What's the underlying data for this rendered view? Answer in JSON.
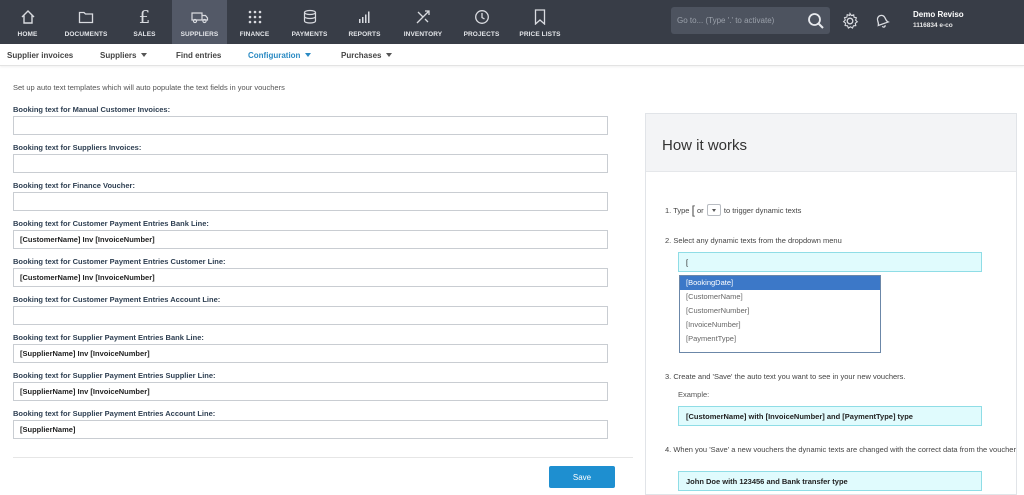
{
  "nav": {
    "items": [
      {
        "label": "HOME",
        "icon": "home-icon"
      },
      {
        "label": "DOCUMENTS",
        "icon": "folder-icon"
      },
      {
        "label": "SALES",
        "icon": "pound-icon"
      },
      {
        "label": "SUPPLIERS",
        "icon": "truck-icon",
        "active": true
      },
      {
        "label": "FINANCE",
        "icon": "grid-icon"
      },
      {
        "label": "PAYMENTS",
        "icon": "coins-icon"
      },
      {
        "label": "REPORTS",
        "icon": "bar-chart-icon"
      },
      {
        "label": "INVENTORY",
        "icon": "inventory-icon"
      },
      {
        "label": "PROJECTS",
        "icon": "clock-icon"
      },
      {
        "label": "PRICE LISTS",
        "icon": "bookmark-icon"
      }
    ]
  },
  "search": {
    "placeholder": "Go to... (Type '.' to activate)"
  },
  "user": {
    "name": "Demo Reviso",
    "account": "1116834 e-co"
  },
  "subnav": {
    "items": [
      {
        "label": "Supplier invoices",
        "dropdown": false
      },
      {
        "label": "Suppliers",
        "dropdown": true
      },
      {
        "label": "Find entries",
        "dropdown": false
      },
      {
        "label": "Configuration",
        "dropdown": true,
        "active": true
      },
      {
        "label": "Purchases",
        "dropdown": true
      }
    ]
  },
  "form": {
    "intro": "Set up auto text templates which will auto populate the text fields in your vouchers",
    "fields": [
      {
        "label": "Booking text for Manual Customer Invoices:",
        "value": ""
      },
      {
        "label": "Booking text for Suppliers Invoices:",
        "value": ""
      },
      {
        "label": "Booking text for Finance Voucher:",
        "value": ""
      },
      {
        "label": "Booking text for Customer Payment Entries Bank Line:",
        "value": "[CustomerName] Inv [InvoiceNumber]"
      },
      {
        "label": "Booking text for Customer Payment Entries Customer Line:",
        "value": "[CustomerName] Inv [InvoiceNumber]"
      },
      {
        "label": "Booking text for Customer Payment Entries Account Line:",
        "value": ""
      },
      {
        "label": "Booking text for Supplier Payment Entries Bank Line:",
        "value": "[SupplierName] Inv [InvoiceNumber]"
      },
      {
        "label": "Booking text for Supplier Payment Entries Supplier Line:",
        "value": "[SupplierName] Inv [InvoiceNumber]"
      },
      {
        "label": "Booking text for Supplier Payment Entries Account Line:",
        "value": "[SupplierName]"
      }
    ],
    "save_label": "Save"
  },
  "how": {
    "title": "How it works",
    "step1_pre": "1. Type",
    "step1_bracket": "[",
    "step1_or": "or",
    "step1_post": "to trigger dynamic texts",
    "step2": "2. Select any dynamic texts from the dropdown menu",
    "step2_input": "[",
    "options": [
      "[BookingDate]",
      "[CustomerName]",
      "[CustomerNumber]",
      "[InvoiceNumber]",
      "[PaymentType]"
    ],
    "step3": "3. Create and 'Save' the auto text you want to see in your new vouchers.",
    "example_label": "Example:",
    "example_text": "[CustomerName] with [InvoiceNumber] and [PaymentType] type",
    "step4": "4. When you 'Save' a new vouchers the dynamic texts are changed with the correct data from the voucher",
    "result_text": "John Doe with 123456 and Bank transfer type"
  }
}
